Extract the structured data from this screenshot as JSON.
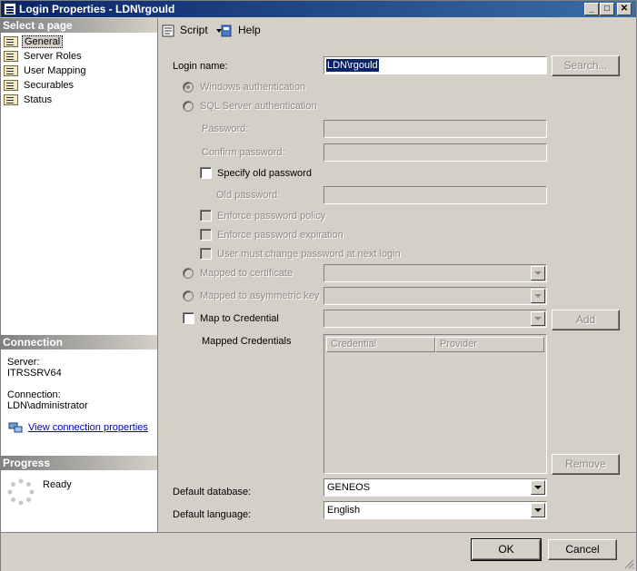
{
  "window": {
    "title": "Login Properties - LDN\\rgould"
  },
  "titlebar_buttons": {
    "minimize": "_",
    "maximize": "□",
    "close": "✕"
  },
  "left": {
    "select_header": "Select a page",
    "pages": [
      {
        "label": "General"
      },
      {
        "label": "Server Roles"
      },
      {
        "label": "User Mapping"
      },
      {
        "label": "Securables"
      },
      {
        "label": "Status"
      }
    ],
    "connection_header": "Connection",
    "server_label": "Server:",
    "server_value": "ITRSSRV64",
    "connection_label": "Connection:",
    "connection_value": "LDN\\administrator",
    "view_props_link": "View connection properties",
    "progress_header": "Progress",
    "progress_status": "Ready"
  },
  "toolbar": {
    "script": "Script",
    "help": "Help"
  },
  "form": {
    "login_name_label": "Login name:",
    "login_name_value": "LDN\\rgould",
    "search_button": "Search...",
    "windows_auth": "Windows authentication",
    "sql_auth": "SQL Server authentication",
    "password_label": "Password:",
    "confirm_password_label": "Confirm password:",
    "specify_old_password": "Specify old password",
    "old_password_label": "Old password:",
    "enforce_policy": "Enforce password policy",
    "enforce_expiration": "Enforce password expiration",
    "must_change": "User must change password at next login",
    "mapped_certificate": "Mapped to certificate",
    "mapped_asym_key": "Mapped to asymmetric key",
    "map_credential": "Map to Credential",
    "add_button": "Add",
    "mapped_credentials_label": "Mapped Credentials",
    "grid_columns": [
      "Credential",
      "Provider"
    ],
    "remove_button": "Remove",
    "default_database_label": "Default database:",
    "default_database_value": "GENEOS",
    "default_language_label": "Default language:",
    "default_language_value": "English"
  },
  "footer": {
    "ok": "OK",
    "cancel": "Cancel"
  }
}
